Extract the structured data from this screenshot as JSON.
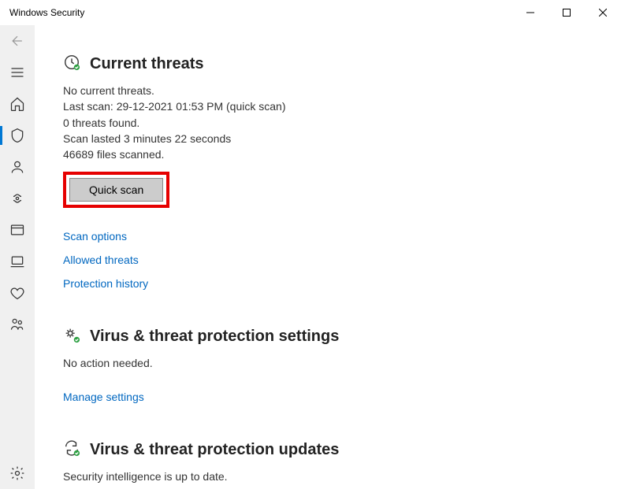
{
  "window": {
    "title": "Windows Security"
  },
  "threats": {
    "title": "Current threats",
    "status": "No current threats.",
    "last_scan": "Last scan: 29-12-2021 01:53 PM (quick scan)",
    "found": "0 threats found.",
    "duration": "Scan lasted 3 minutes 22 seconds",
    "files": "46689 files scanned.",
    "quick_scan_label": "Quick scan",
    "links": {
      "scan_options": "Scan options",
      "allowed_threats": "Allowed threats",
      "protection_history": "Protection history"
    }
  },
  "settings": {
    "title": "Virus & threat protection settings",
    "status": "No action needed.",
    "manage_link": "Manage settings"
  },
  "updates": {
    "title": "Virus & threat protection updates",
    "status": "Security intelligence is up to date."
  }
}
